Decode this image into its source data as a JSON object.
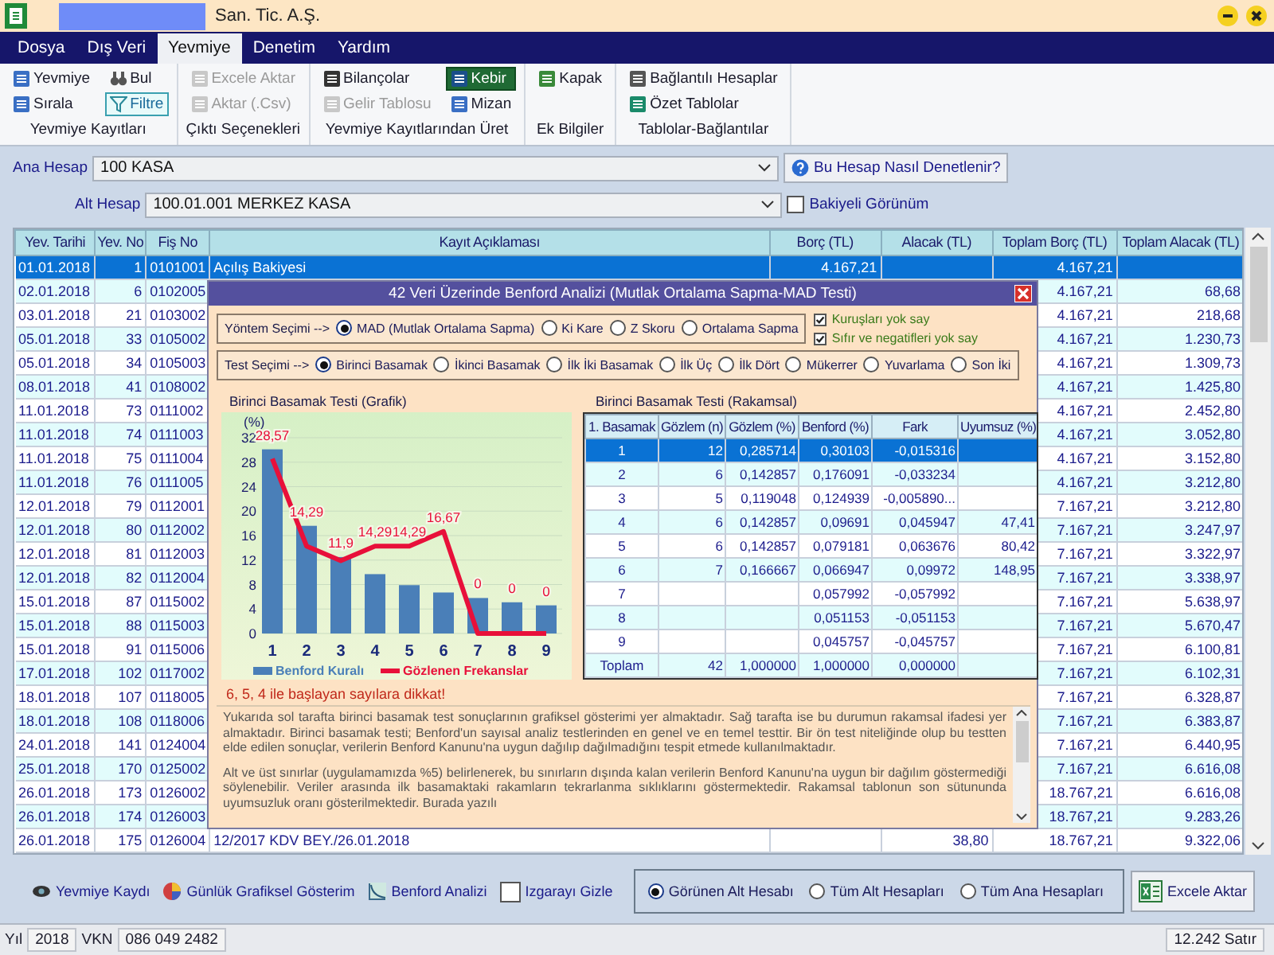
{
  "window": {
    "title": "San. Tic. A.Ş."
  },
  "menu": [
    {
      "label": "Dosya",
      "selected": false
    },
    {
      "label": "Dış Veri",
      "selected": false
    },
    {
      "label": "Yevmiye",
      "selected": true
    },
    {
      "label": "Denetim",
      "selected": false
    },
    {
      "label": "Yardım",
      "selected": false
    }
  ],
  "ribbon": {
    "groups": [
      {
        "label": "Yevmiye Kayıtları",
        "items": [
          {
            "label": "Yevmiye",
            "on": false,
            "disabled": false
          },
          {
            "label": "Bul",
            "on": false,
            "disabled": false
          },
          {
            "label": "Sırala",
            "on": false,
            "disabled": false
          },
          {
            "label": "Filtre",
            "on": true,
            "disabled": false
          }
        ]
      },
      {
        "label": "Çıktı Seçenekleri",
        "items": [
          {
            "label": "Excele Aktar",
            "disabled": true
          },
          {
            "label": "Aktar (.Csv)",
            "disabled": true
          }
        ]
      },
      {
        "label": "Yevmiye Kayıtlarından Üret",
        "items": [
          {
            "label": "Bilançolar",
            "selected": false,
            "disabled": false
          },
          {
            "label": "Kebir",
            "selected": true,
            "disabled": false
          },
          {
            "label": "Gelir Tablosu",
            "selected": false,
            "disabled": true
          },
          {
            "label": "Mizan",
            "selected": false,
            "disabled": false
          }
        ]
      },
      {
        "label": "Ek Bilgiler",
        "items": [
          {
            "label": "Kapak",
            "disabled": false
          }
        ]
      },
      {
        "label": "Tablolar-Bağlantılar",
        "items": [
          {
            "label": "Bağlantılı Hesaplar",
            "disabled": false
          },
          {
            "label": "Özet Tablolar",
            "disabled": false
          }
        ]
      }
    ]
  },
  "account": {
    "main_label": "Ana Hesap",
    "main_value": "100 KASA",
    "help_button": "Bu Hesap Nasıl Denetlenir?",
    "sub_label": "Alt Hesap",
    "sub_value": "100.01.001 MERKEZ KASA",
    "balance_view": {
      "label": "Bakiyeli Görünüm",
      "checked": false
    }
  },
  "table": {
    "columns": [
      "Yev. Tarihi",
      "Yev. No",
      "Fiş No",
      "Kayıt Açıklaması",
      "Borç (TL)",
      "Alacak (TL)",
      "Toplam Borç (TL)",
      "Toplam Alacak (TL)"
    ],
    "rows": [
      {
        "date": "01.01.2018",
        "no": "1",
        "voucher": "0101001",
        "description": "Açılış Bakiyesi",
        "debit": "4.167,21",
        "total_debit": "4.167,21",
        "selected": true
      },
      {
        "date": "02.01.2018",
        "no": "6",
        "voucher": "0102005",
        "total_debit": "4.167,21",
        "total_credit": "68,68",
        "selected": false
      },
      {
        "date": "03.01.2018",
        "no": "21",
        "voucher": "0103002",
        "total_debit": "4.167,21",
        "total_credit": "218,68",
        "selected": false
      },
      {
        "date": "05.01.2018",
        "no": "33",
        "voucher": "0105002",
        "total_debit": "4.167,21",
        "total_credit": "1.230,73",
        "selected": false
      },
      {
        "date": "05.01.2018",
        "no": "34",
        "voucher": "0105003",
        "total_debit": "4.167,21",
        "total_credit": "1.309,73",
        "selected": false
      },
      {
        "date": "08.01.2018",
        "no": "41",
        "voucher": "0108002",
        "total_debit": "4.167,21",
        "total_credit": "1.425,80",
        "selected": false
      },
      {
        "date": "11.01.2018",
        "no": "73",
        "voucher": "0111002",
        "total_debit": "4.167,21",
        "total_credit": "2.452,80",
        "selected": false
      },
      {
        "date": "11.01.2018",
        "no": "74",
        "voucher": "0111003",
        "total_debit": "4.167,21",
        "total_credit": "3.052,80",
        "selected": false
      },
      {
        "date": "11.01.2018",
        "no": "75",
        "voucher": "0111004",
        "total_debit": "4.167,21",
        "total_credit": "3.152,80",
        "selected": false
      },
      {
        "date": "11.01.2018",
        "no": "76",
        "voucher": "0111005",
        "total_debit": "4.167,21",
        "total_credit": "3.212,80",
        "selected": false
      },
      {
        "date": "12.01.2018",
        "no": "79",
        "voucher": "0112001",
        "total_debit": "7.167,21",
        "total_credit": "3.212,80",
        "selected": false
      },
      {
        "date": "12.01.2018",
        "no": "80",
        "voucher": "0112002",
        "total_debit": "7.167,21",
        "total_credit": "3.247,97",
        "selected": false
      },
      {
        "date": "12.01.2018",
        "no": "81",
        "voucher": "0112003",
        "total_debit": "7.167,21",
        "total_credit": "3.322,97",
        "selected": false
      },
      {
        "date": "12.01.2018",
        "no": "82",
        "voucher": "0112004",
        "total_debit": "7.167,21",
        "total_credit": "3.338,97",
        "selected": false
      },
      {
        "date": "15.01.2018",
        "no": "87",
        "voucher": "0115002",
        "total_debit": "7.167,21",
        "total_credit": "5.638,97",
        "selected": false
      },
      {
        "date": "15.01.2018",
        "no": "88",
        "voucher": "0115003",
        "total_debit": "7.167,21",
        "total_credit": "5.670,47",
        "selected": false
      },
      {
        "date": "15.01.2018",
        "no": "91",
        "voucher": "0115006",
        "total_debit": "7.167,21",
        "total_credit": "6.100,81",
        "selected": false
      },
      {
        "date": "17.01.2018",
        "no": "102",
        "voucher": "0117002",
        "total_debit": "7.167,21",
        "total_credit": "6.102,31",
        "selected": false
      },
      {
        "date": "18.01.2018",
        "no": "107",
        "voucher": "0118005",
        "total_debit": "7.167,21",
        "total_credit": "6.328,87",
        "selected": false
      },
      {
        "date": "18.01.2018",
        "no": "108",
        "voucher": "0118006",
        "total_debit": "7.167,21",
        "total_credit": "6.383,87",
        "selected": false
      },
      {
        "date": "24.01.2018",
        "no": "141",
        "voucher": "0124004",
        "total_debit": "7.167,21",
        "total_credit": "6.440,95",
        "selected": false
      },
      {
        "date": "25.01.2018",
        "no": "170",
        "voucher": "0125002",
        "total_debit": "7.167,21",
        "total_credit": "6.616,08",
        "selected": false
      },
      {
        "date": "26.01.2018",
        "no": "173",
        "voucher": "0126002",
        "total_debit": "18.767,21",
        "total_credit": "6.616,08",
        "selected": false
      },
      {
        "date": "26.01.2018",
        "no": "174",
        "voucher": "0126003",
        "total_debit": "18.767,21",
        "total_credit": "9.283,26",
        "selected": false
      },
      {
        "date": "26.01.2018",
        "no": "175",
        "voucher": "0126004",
        "description": "12/2017 KDV BEY./26.01.2018",
        "credit": "38,80",
        "total_debit": "18.767,21",
        "total_credit": "9.322,06",
        "selected": false
      }
    ]
  },
  "dialog": {
    "title": "42 Veri Üzerinde Benford Analizi (Mutlak Ortalama Sapma-MAD Testi)",
    "method_label": "Yöntem Seçimi -->",
    "methods": [
      {
        "label": "MAD (Mutlak Ortalama Sapma)",
        "selected": true
      },
      {
        "label": "Ki Kare",
        "selected": false
      },
      {
        "label": "Z Skoru",
        "selected": false
      },
      {
        "label": "Ortalama Sapma",
        "selected": false
      }
    ],
    "options": [
      {
        "label": "Kuruşları yok say",
        "checked": true
      },
      {
        "label": "Sıfır ve negatifleri yok say",
        "checked": true
      }
    ],
    "test_label": "Test Seçimi -->",
    "tests": [
      {
        "label": "Birinci Basamak",
        "selected": true
      },
      {
        "label": "İkinci Basamak",
        "selected": false
      },
      {
        "label": "İlk İki Basamak",
        "selected": false
      },
      {
        "label": "İlk Üç",
        "selected": false
      },
      {
        "label": "İlk Dört",
        "selected": false
      },
      {
        "label": "Mükerrer",
        "selected": false
      },
      {
        "label": "Yuvarlama",
        "selected": false
      },
      {
        "label": "Son İki",
        "selected": false
      }
    ],
    "chart_data": {
      "type": "bar",
      "title": "Birinci Basamak Testi (Grafik)",
      "ylabel": "(%)",
      "categories": [
        "1",
        "2",
        "3",
        "4",
        "5",
        "6",
        "7",
        "8",
        "9"
      ],
      "ylim": [
        0,
        32
      ],
      "yticks": [
        0,
        4,
        8,
        12,
        16,
        20,
        24,
        28,
        32
      ],
      "grid": true,
      "legend": true,
      "series": [
        {
          "name": "Benford Kuralı",
          "type": "bar",
          "color": "#4a7fb8",
          "values": [
            30.1,
            17.6,
            12.5,
            9.7,
            7.9,
            6.7,
            5.8,
            5.1,
            4.6
          ]
        },
        {
          "name": "Gözlenen Frekanslar",
          "type": "line",
          "color": "#e8103a",
          "values": [
            28.57,
            14.29,
            11.9,
            14.29,
            14.29,
            16.67,
            0,
            0,
            0
          ],
          "value_labels": [
            "28,57",
            "14,29",
            "11,9",
            "14,29",
            "14,29",
            "16,67",
            "0",
            "0",
            "0"
          ]
        }
      ]
    },
    "table_title": "Birinci Basamak Testi (Rakamsal)",
    "table": {
      "columns": [
        "1. Basamak",
        "Gözlem (n)",
        "Gözlem (%)",
        "Benford (%)",
        "Fark",
        "Uyumsuz (%)"
      ],
      "rows": [
        {
          "digit": "1",
          "count": "12",
          "observed": "0,285714",
          "benford": "0,30103",
          "diff": "-0,015316",
          "selected": true
        },
        {
          "digit": "2",
          "count": "6",
          "observed": "0,142857",
          "benford": "0,176091",
          "diff": "-0,033234",
          "selected": false
        },
        {
          "digit": "3",
          "count": "5",
          "observed": "0,119048",
          "benford": "0,124939",
          "diff": "-0,005890...",
          "selected": false
        },
        {
          "digit": "4",
          "count": "6",
          "observed": "0,142857",
          "benford": "0,09691",
          "diff": "0,045947",
          "misfit": "47,41",
          "selected": false
        },
        {
          "digit": "5",
          "count": "6",
          "observed": "0,142857",
          "benford": "0,079181",
          "diff": "0,063676",
          "misfit": "80,42",
          "selected": false
        },
        {
          "digit": "6",
          "count": "7",
          "observed": "0,166667",
          "benford": "0,066947",
          "diff": "0,09972",
          "misfit": "148,95",
          "selected": false
        },
        {
          "digit": "7",
          "benford": "0,057992",
          "diff": "-0,057992",
          "selected": false
        },
        {
          "digit": "8",
          "benford": "0,051153",
          "diff": "-0,051153",
          "selected": false
        },
        {
          "digit": "9",
          "benford": "0,045757",
          "diff": "-0,045757",
          "selected": false
        },
        {
          "digit": "Toplam",
          "count": "42",
          "observed": "1,000000",
          "benford": "1,000000",
          "diff": "0,000000",
          "selected": false
        }
      ]
    },
    "warning": "6, 5, 4 ile başlayan sayılara dikkat!",
    "paragraphs": [
      "Yukarıda sol tarafta birinci basamak test sonuçlarının grafiksel gösterimi yer almaktadır. Sağ tarafta ise bu durumun rakamsal ifadesi yer almaktadır. Birinci basamak testi; Benford'un sayısal analiz testlerinden en genel ve en temel testtir. Bir ön test niteliğinde olup bu testten elde edilen sonuçlar, verilerin Benford Kanunu'na uygun dağılıp dağılmadığını tespit etmede kullanılmaktadır.",
      "Alt ve üst sınırlar (uygulamamızda %5) belirlenerek, bu sınırların dışında kalan verilerin Benford Kanunu'na uygun bir dağılım göstermediği söylenebilir. Veriler arasında ilk basamaktaki rakamların tekrarlanma sıklıklarını göstermektedir. Rakamsal tablonun son sütununda uyumsuzluk oranı gösterilmektedir. Burada yazılı"
    ]
  },
  "bottom": {
    "tools": [
      "Yevmiye Kaydı",
      "Günlük Grafiksel Gösterim",
      "Benford Analizi"
    ],
    "hide_grid": {
      "label": "Izgarayı Gizle",
      "checked": false
    },
    "scopes": [
      {
        "label": "Görünen Alt Hesabı",
        "selected": true
      },
      {
        "label": "Tüm Alt Hesapları",
        "selected": false
      },
      {
        "label": "Tüm Ana Hesapları",
        "selected": false
      }
    ],
    "export_button": "Excele Aktar"
  },
  "status_bar": {
    "year_label": "Yıl",
    "year": "2018",
    "vkn_label": "VKN",
    "vkn": "086 049 2482",
    "row_count": "12.242 Satır"
  }
}
